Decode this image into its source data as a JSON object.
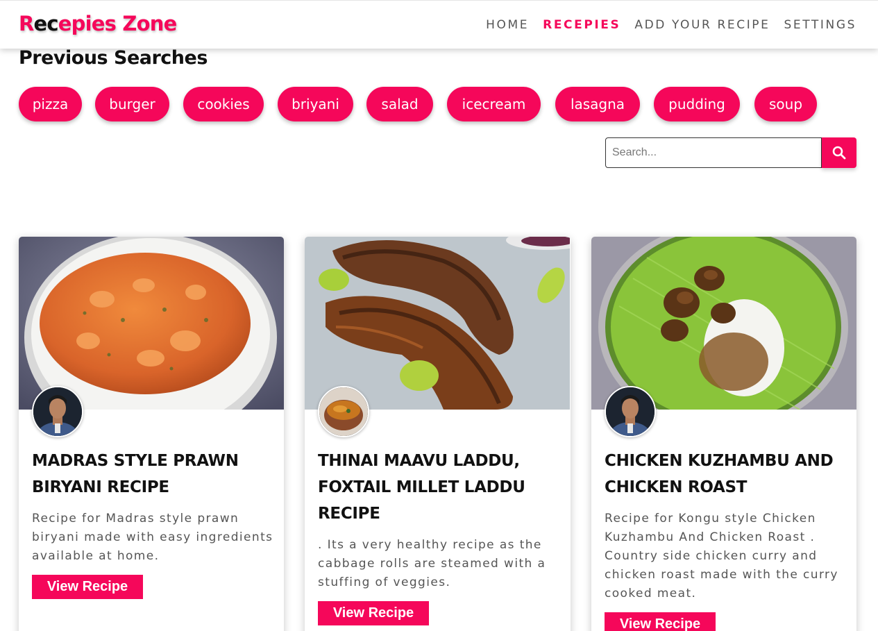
{
  "header": {
    "logo_parts": [
      "R",
      "ec",
      "epies Zone"
    ],
    "nav": [
      {
        "label": "HOME"
      },
      {
        "label": "RECEPIES",
        "active": true
      },
      {
        "label": "ADD YOUR RECIPE"
      },
      {
        "label": "SETTINGS"
      }
    ]
  },
  "previous_searches": {
    "title": "Previous Searches",
    "chips": [
      "pizza",
      "burger",
      "cookies",
      "briyani",
      "salad",
      "icecream",
      "lasagna",
      "pudding",
      "soup"
    ]
  },
  "search": {
    "placeholder": "Search...",
    "icon": "search-icon"
  },
  "cards": [
    {
      "title": "MADRAS STYLE PRAWN BIRYANI RECIPE",
      "description": "Recipe for Madras style prawn biryani made with easy ingredients available at home.",
      "button": "View Recipe",
      "image": "prawn-biryani-bowl",
      "avatar": "chef-avatar"
    },
    {
      "title": "THINAI MAAVU LADDU, FOXTAIL MILLET LADDU RECIPE",
      "description": ". Its a very healthy recipe as the cabbage rolls are steamed with a stuffing of veggies.",
      "button": "View Recipe",
      "image": "grilled-chicken-legs",
      "avatar": "curry-pot-avatar"
    },
    {
      "title": "CHICKEN KUZHAMBU AND CHICKEN ROAST",
      "description": "Recipe for Kongu style Chicken Kuzhambu And Chicken Roast . Country side chicken curry and chicken roast made with the curry cooked meat.",
      "button": "View Recipe",
      "image": "chicken-curry-rice-plate",
      "avatar": "chef-avatar"
    }
  ],
  "colors": {
    "accent": "#f5075a",
    "text_dark": "#111111",
    "text_muted": "#555555"
  }
}
